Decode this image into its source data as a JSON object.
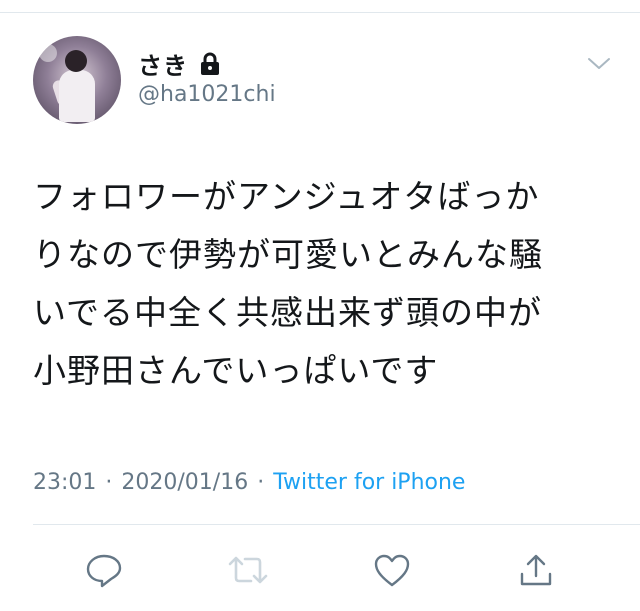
{
  "author": {
    "display_name": "さき",
    "handle": "@ha1021chi",
    "protected": true
  },
  "tweet": {
    "lines": [
      "フォロワーがアンジュオタばっか",
      "りなので伊勢が可愛いとみんな騒",
      "いでる中全く共感出来ず頭の中が",
      "小野田さんでいっぱいです"
    ]
  },
  "meta": {
    "time": "23:01",
    "separator": "·",
    "date": "2020/01/16",
    "source": "Twitter for iPhone"
  },
  "icons": {
    "lock": "lock-icon",
    "menu": "chevron-down-icon",
    "reply": "reply-icon",
    "retweet": "retweet-icon",
    "like": "heart-icon",
    "share": "share-icon"
  },
  "colors": {
    "text": "#14171a",
    "secondary": "#657786",
    "link": "#1da1f2",
    "icon": "#657786",
    "retweet_disabled": "#ccd6dd",
    "divider": "#e1e8ed"
  }
}
